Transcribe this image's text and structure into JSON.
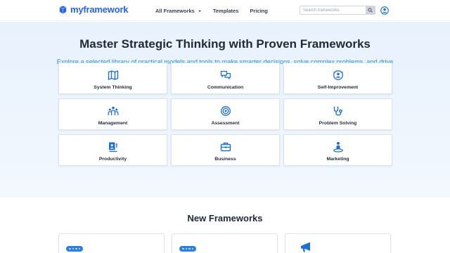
{
  "brand": {
    "name": "myframework",
    "color": "#2563eb",
    "icon": "cube-logo-icon"
  },
  "nav": {
    "items": [
      {
        "label": "All Frameworks",
        "has_dropdown": true
      },
      {
        "label": "Templates"
      },
      {
        "label": "Pricing"
      }
    ]
  },
  "search": {
    "placeholder": "Search frameworks",
    "icon": "search-icon"
  },
  "user": {
    "icon": "user-circle-icon"
  },
  "hero": {
    "title": "Master Strategic Thinking with Proven Frameworks",
    "subtitle": "Explore a selected library of practical models and tools to make smarter decisions, solve complex problems, and drive success—quickly and effectively."
  },
  "categories": [
    {
      "label": "System Thinking",
      "icon": "map-icon"
    },
    {
      "label": "Communication",
      "icon": "chat-bubbles-icon"
    },
    {
      "label": "Self-Improvement",
      "icon": "self-improvement-icon"
    },
    {
      "label": "Management",
      "icon": "team-icon"
    },
    {
      "label": "Assessment",
      "icon": "target-icon"
    },
    {
      "label": "Problem Solving",
      "icon": "stethoscope-icon"
    },
    {
      "label": "Productivity",
      "icon": "productivity-icon"
    },
    {
      "label": "Business",
      "icon": "briefcase-icon"
    },
    {
      "label": "Marketing",
      "icon": "marketing-person-icon"
    }
  ],
  "new_frameworks": {
    "title": "New Frameworks",
    "cards": [
      {
        "icon": "dots-badge-icon"
      },
      {
        "icon": "dots-badge-icon"
      },
      {
        "icon": "megaphone-icon"
      }
    ]
  },
  "colors": {
    "accent": "#1d8fe0",
    "icon_blue": "#1f6fd1",
    "hero_bg": "#e8f2fd"
  }
}
